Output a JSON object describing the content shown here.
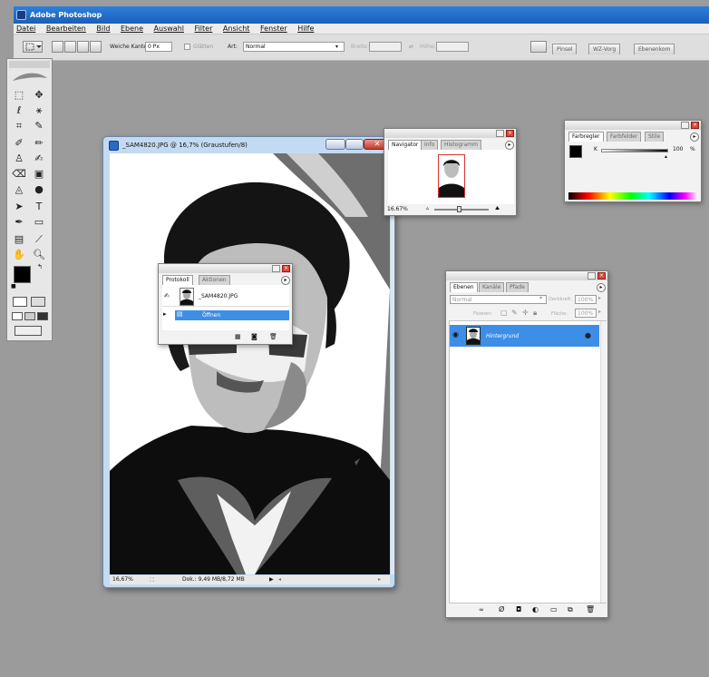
{
  "window": {
    "title": "Adobe Photoshop"
  },
  "menu": [
    "Datei",
    "Bearbeiten",
    "Bild",
    "Ebene",
    "Auswahl",
    "Filter",
    "Ansicht",
    "Fenster",
    "Hilfe"
  ],
  "options": {
    "feather_label": "Weiche Kante:",
    "feather_value": "0 Px",
    "antialias_label": "Glätten",
    "style_label": "Art:",
    "style_value": "Normal",
    "width_label": "Breite:",
    "height_label": "Höhe:"
  },
  "dock_tabs": [
    "Pinsel",
    "WZ-Vorg",
    "Ebenenkom"
  ],
  "document": {
    "title": "_SAM4820.JPG @ 16,7% (Graustufen/8)",
    "zoom": "16,67%",
    "doc_size": "Dok.: 9,49 MB/8,72 MB"
  },
  "navigator": {
    "tabs": [
      "Navigator",
      "Info",
      "Histogramm"
    ],
    "zoom": "16.67%"
  },
  "color": {
    "tabs": [
      "Farbregler",
      "Farbfelder",
      "Stile"
    ],
    "channel": "K",
    "value": "100",
    "unit": "%"
  },
  "history": {
    "tabs": [
      "Protokoll",
      "Aktionen"
    ],
    "items": [
      "_SAM4820.JPG",
      "Öffnen"
    ]
  },
  "layers": {
    "tabs": [
      "Ebenen",
      "Kanäle",
      "Pfade"
    ],
    "blend_mode": "Normal",
    "opacity_label": "Deckkraft:",
    "opacity_value": "100%",
    "lock_label": "Fixieren:",
    "fill_label": "Fläche:",
    "fill_value": "100%",
    "layer_name": "Hintergrund"
  },
  "colors": {
    "titlebar": "#1f66c2",
    "selection": "#3d8ee6",
    "workspace": "#9b9b9b"
  }
}
